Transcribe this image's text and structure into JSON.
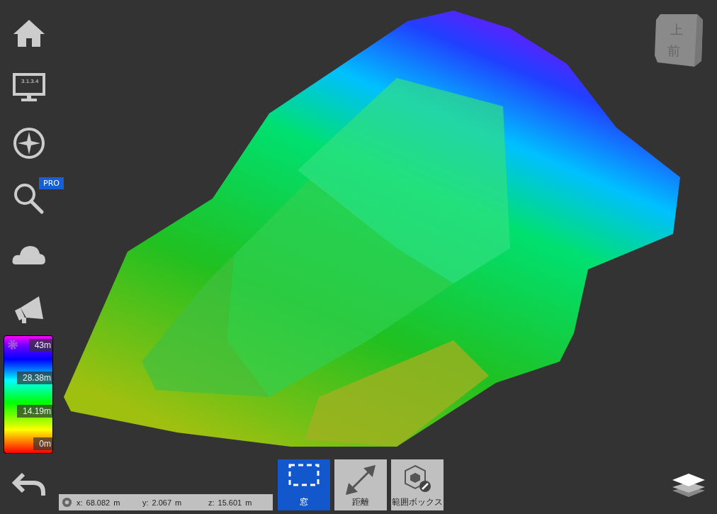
{
  "sidebar": {
    "version": "3.1.3.4",
    "search_badge": "PRO"
  },
  "legend": {
    "labels": [
      "43m",
      "28.38m",
      "14.19m",
      "0m"
    ]
  },
  "view_cube": {
    "top": "上",
    "front": "前"
  },
  "coordinates": [
    {
      "axis": "x:",
      "value": "68.082",
      "unit": "m"
    },
    {
      "axis": "y:",
      "value": "2.067",
      "unit": "m"
    },
    {
      "axis": "z:",
      "value": "15.601",
      "unit": "m"
    }
  ],
  "tools": [
    {
      "label": "窓",
      "kind": "window",
      "selected": true
    },
    {
      "label": "距離",
      "kind": "distance",
      "selected": false
    },
    {
      "label": "範囲ボックス",
      "kind": "box",
      "selected": false
    }
  ]
}
